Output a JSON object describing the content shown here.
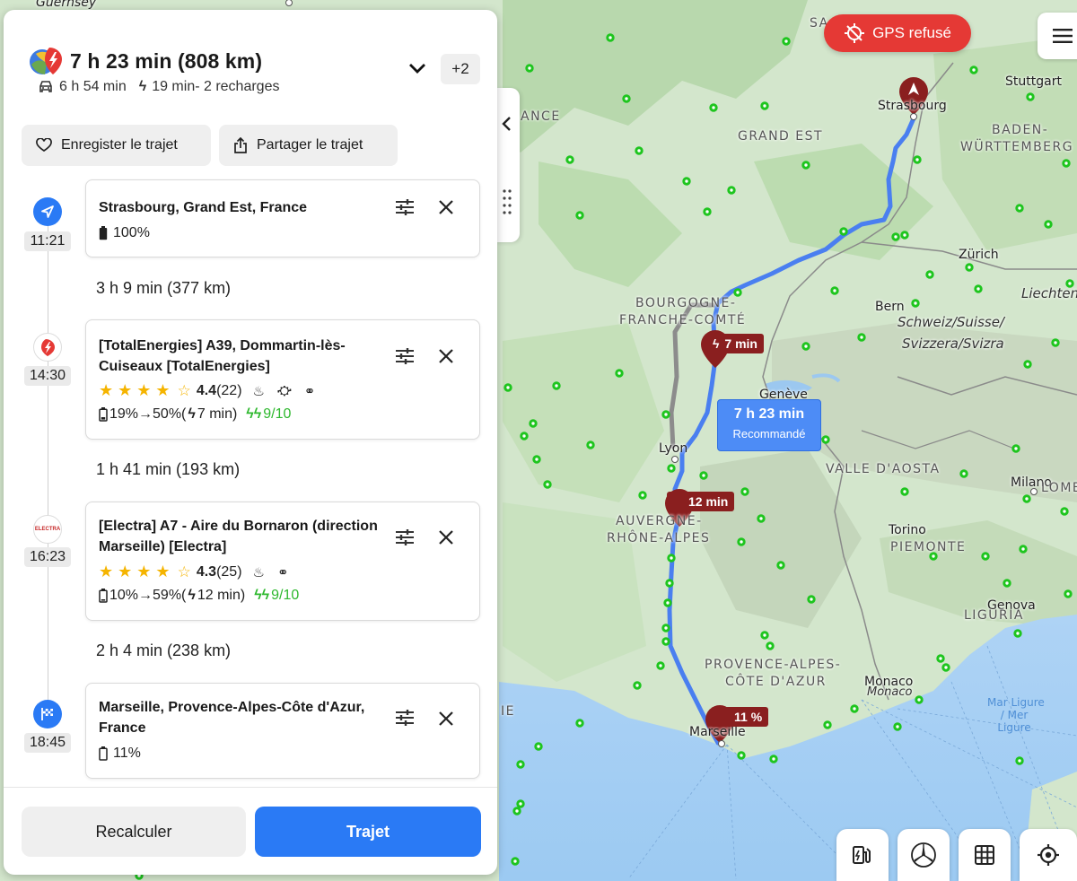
{
  "map": {
    "labels": {
      "guernsey": "Guernsey",
      "france_edge": "ANCE",
      "france_edge2": "IE",
      "sa": "SA",
      "grand_est": "GRAND EST",
      "baden": "BADEN-",
      "wurttemberg": "WÜRTTEMBERG",
      "stuttgart": "Stuttgart",
      "strasbourg": "Strasbourg",
      "zurich": "Zürich",
      "liechtenstein": "Liechtenst",
      "bern": "Bern",
      "swiss1": "Schweiz/Suisse/",
      "swiss2": "Svizzera/Svizra",
      "bfc1": "BOURGOGNE-",
      "bfc2": "FRANCHE-COMTÉ",
      "geneve": "Genève",
      "lyon": "Lyon",
      "vda": "VALLE D'AOSTA",
      "milano": "Milano",
      "lombardia": "LOMB",
      "ara1": "AUVERGNE-",
      "ara2": "RHÔNE-ALPES",
      "torino": "Torino",
      "piemonte": "PIEMONTE",
      "genova": "Genova",
      "liguria": "LIGURIA",
      "paca1": "PROVENCE-ALPES-",
      "paca2": "CÔTE D'AZUR",
      "monaco1": "Monaco",
      "monaco2": "Monaco",
      "marseille": "Marseille",
      "sea1": "Mar Ligure",
      "sea2": "/ Mer",
      "sea3": "Ligure"
    },
    "gps_status": "GPS refusé",
    "route_bubble": {
      "time": "7 h 23 min",
      "label": "Recommandé"
    },
    "tags": {
      "stop1": "7 min",
      "stop2": "12 min",
      "arrival": "11 %"
    },
    "colors": {
      "route": "#4a7ff0",
      "route_alt": "#8c8c8c",
      "charger": "#1ec51e",
      "marker": "#8a1f1f"
    }
  },
  "panel": {
    "title": "7 h 23 min (808 km)",
    "drive_time": "6 h 54 min",
    "charge_info": "19 min- 2 recharges",
    "more_count": "+2",
    "save_label": "Enregister le trajet",
    "share_label": "Partager le trajet",
    "stops": [
      {
        "time": "11:21",
        "name": "Strasbourg, Grand Est, France",
        "battery": "100%"
      },
      {
        "time": "14:30",
        "name": "[TotalEnergies] A39, Dommartin-lès-Cuiseaux [TotalEnergies]",
        "rating": "4.4",
        "reviews": "(22)",
        "charge": "19%→50%(",
        "charge_time": "7 min)",
        "score": "9/10"
      },
      {
        "time": "16:23",
        "name": "[Electra] A7 - Aire du Bornaron (direction Marseille) [Electra]",
        "logo": "ELECTRA",
        "rating": "4.3",
        "reviews": "(25)",
        "charge": "10%→59%(",
        "charge_time": "12 min)",
        "score": "9/10"
      },
      {
        "time": "18:45",
        "name": "Marseille, Provence-Alpes-Côte d'Azur, France",
        "battery": "11%"
      }
    ],
    "segments": [
      "3 h 9 min (377 km)",
      "1 h 41 min (193 km)",
      "2 h 4 min (238 km)"
    ],
    "recalc_label": "Recalculer",
    "route_label": "Trajet"
  }
}
